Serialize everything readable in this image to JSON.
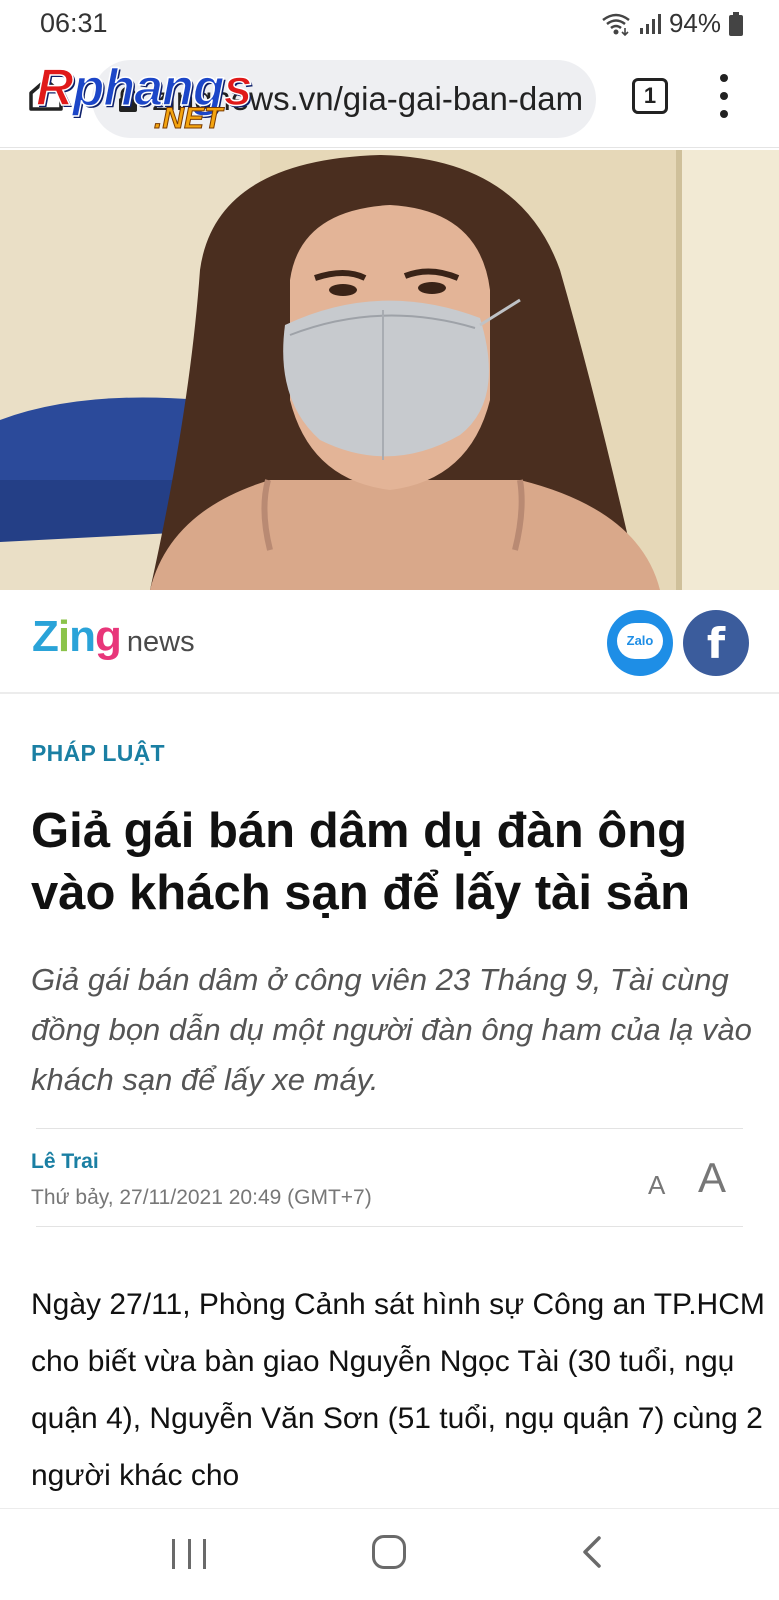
{
  "status_bar": {
    "time": "06:31",
    "battery": "94%"
  },
  "browser": {
    "url": "zingnews.vn/gia-gai-ban-dam",
    "tab_count": "1"
  },
  "watermark": {
    "main": "Rphangs",
    "suffix": ".NET"
  },
  "brand": {
    "logo_word": "Zing",
    "logo_suffix": "news",
    "zalo_label": "Zalo",
    "facebook_label": "f"
  },
  "article": {
    "category": "PHÁP LUẬT",
    "title": "Giả gái bán dâm dụ đàn ông vào khách sạn để lấy tài sản",
    "sapo": "Giả gái bán dâm ở công viên 23 Tháng 9, Tài cùng đồng bọn dẫn dụ một người đàn ông ham của lạ vào khách sạn để lấy xe máy.",
    "author": "Lê Trai",
    "date": "Thứ bảy, 27/11/2021 20:49 (GMT+7)",
    "font_small": "A",
    "font_large": "A",
    "body": "Ngày 27/11, Phòng Cảnh sát hình sự Công an TP.HCM cho biết vừa bàn giao Nguyễn Ngọc Tài (30 tuổi, ngụ quận 4), Nguyễn Văn Sơn (51 tuổi, ngụ quận 7) cùng 2 người khác cho"
  },
  "colors": {
    "accent": "#1a7fa3",
    "zalo": "#1e8ee6",
    "facebook": "#3b5c9c"
  },
  "icons": [
    "wifi-icon",
    "signal-icon",
    "battery-icon",
    "home-icon",
    "lock-icon",
    "menu-icon",
    "recent-apps-icon",
    "home-nav-icon",
    "back-icon"
  ]
}
